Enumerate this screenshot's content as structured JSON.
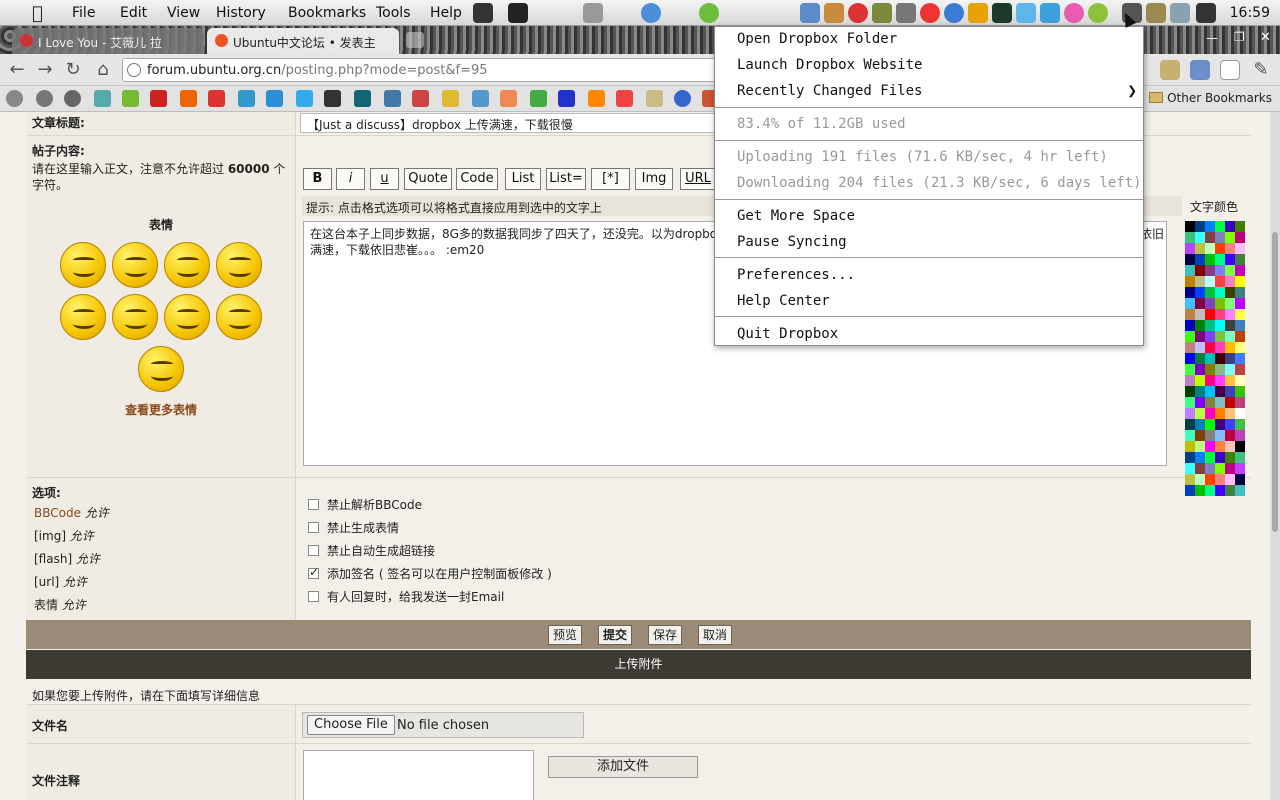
{
  "menubar": {
    "apple": "",
    "items": [
      "File",
      "Edit",
      "View",
      "History",
      "Bookmarks",
      "Tools",
      "Help"
    ],
    "clock": "16:59"
  },
  "tabs": [
    {
      "title": "I Love You - 艾薇儿 拉",
      "active": false
    },
    {
      "title": "Ubuntu中文论坛 • 发表主",
      "active": true
    }
  ],
  "address": {
    "host": "forum.ubuntu.org.cn",
    "path": "/posting.php?mode=post&f=95"
  },
  "bookmarks": {
    "other": "Other Bookmarks"
  },
  "form": {
    "subject_label": "文章标题:",
    "subject_value": "【Just a discuss】dropbox 上传满速，下载很慢",
    "body_label": "帖子内容:",
    "body_help_pre": "请在这里输入正文，注意不允许超过 ",
    "body_help_count": "60000",
    "body_help_post": " 个字符。",
    "smilies_label": "表情",
    "more_smilies": "查看更多表情",
    "format_buttons": [
      "B",
      "i",
      "u",
      "Quote",
      "Code",
      "List",
      "List=",
      "[*]",
      "Img",
      "URL"
    ],
    "hint": "提示: 点击格式选项可以将格式直接应用到选中的文字上",
    "body_line1": "在这台本子上同步数据，8G多的数据我同步了四天了，还没完。以为dropbox",
    "body_line1_tail": "依旧",
    "body_line2": "满速，下载依旧悲崔。。。 :em20",
    "palette_title": "文字颜色",
    "options_label": "选项:",
    "options_left": [
      {
        "code": "BBCode",
        "allow": "允许"
      },
      {
        "code": "[img]",
        "allow": "允许"
      },
      {
        "code": "[flash]",
        "allow": "允许"
      },
      {
        "code": "[url]",
        "allow": "允许"
      },
      {
        "code": "表情",
        "allow": "允许"
      }
    ],
    "checkboxes": [
      {
        "label": "禁止解析BBCode",
        "checked": false
      },
      {
        "label": "禁止生成表情",
        "checked": false
      },
      {
        "label": "禁止自动生成超链接",
        "checked": false
      },
      {
        "label": "添加签名 ( 签名可以在用户控制面板修改 )",
        "checked": true
      },
      {
        "label": "有人回复时，给我发送一封Email",
        "checked": false
      }
    ],
    "submit_buttons": [
      "预览",
      "提交",
      "保存",
      "取消"
    ],
    "attach_header": "上传附件",
    "attach_note": "如果您要上传附件，请在下面填写详细信息",
    "filename_label": "文件名",
    "choose_file": "Choose File",
    "no_file": "No file chosen",
    "file_comment_label": "文件注释",
    "add_file": "添加文件"
  },
  "dropbox_menu": {
    "open_folder": "Open Dropbox Folder",
    "launch_site": "Launch Dropbox Website",
    "recent": "Recently Changed Files",
    "usage": "83.4% of 11.2GB used",
    "uploading": "Uploading 191 files (71.6 KB/sec, 4 hr left)",
    "downloading": "Downloading 204 files (21.3 KB/sec, 6 days left)",
    "more_space": "Get More Space",
    "pause": "Pause Syncing",
    "prefs": "Preferences...",
    "help": "Help Center",
    "quit": "Quit Dropbox"
  },
  "colors": {
    "accent": "#9b8b76",
    "dark_header": "#3d3a34",
    "code_link": "#8a4a1a"
  }
}
